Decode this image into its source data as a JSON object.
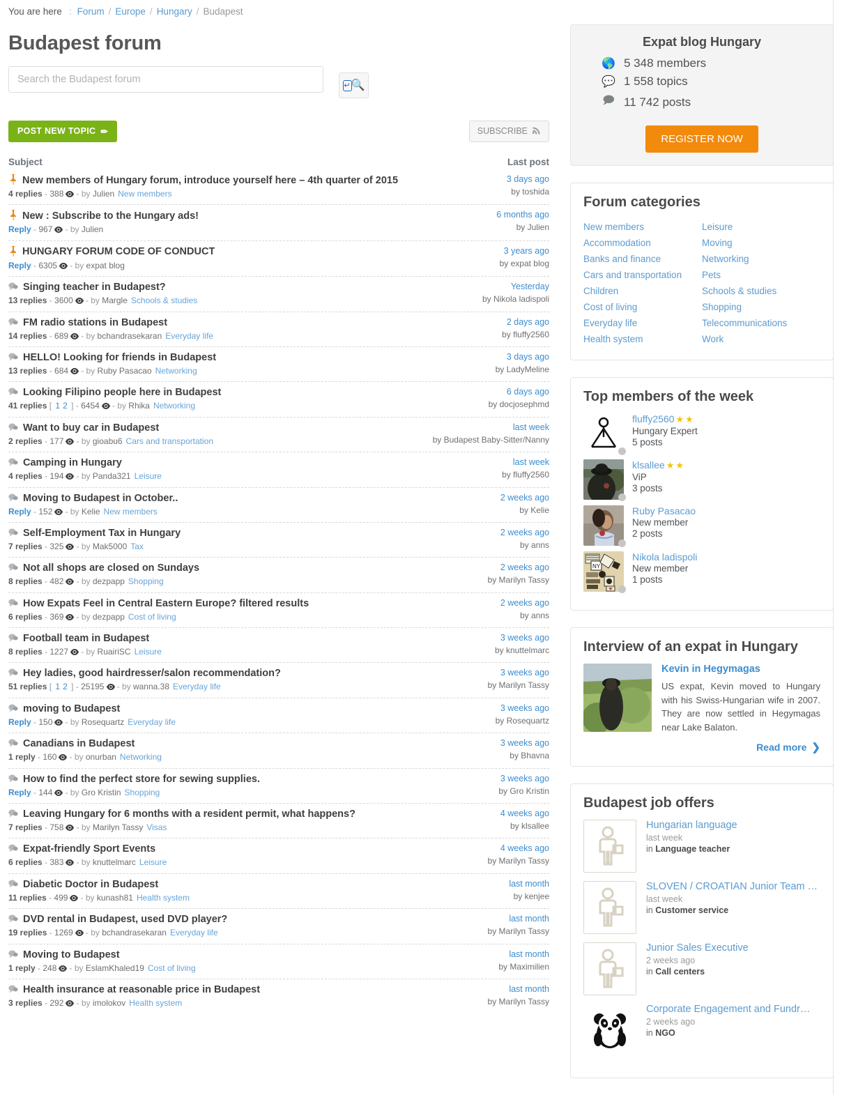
{
  "breadcrumb": {
    "label": "You are here",
    "colon": ":",
    "items": [
      "Forum",
      "Europe",
      "Hungary"
    ],
    "current": "Budapest",
    "separator": "/"
  },
  "page_title": "Budapest forum",
  "search": {
    "placeholder": "Search the Budapest forum",
    "value": ""
  },
  "toolbar": {
    "post_new_topic": "POST NEW TOPIC",
    "pencil_icon": "✏",
    "subscribe": "SUBSCRIBE",
    "rss_icon": "❧"
  },
  "table_headers": {
    "subject": "Subject",
    "last_post": "Last post"
  },
  "topics": [
    {
      "pinned": true,
      "title": "New members of Hungary forum, introduce yourself here – 4th quarter of 2015",
      "replies": "4 replies",
      "reply_link": "",
      "views": "388",
      "author": "Julien",
      "category": "New members",
      "pages": [],
      "when": "3 days ago",
      "last_by": "by toshida"
    },
    {
      "pinned": true,
      "title": "New : Subscribe to the Hungary ads!",
      "replies": "",
      "reply_link": "Reply",
      "views": "967",
      "author": "Julien",
      "category": "",
      "pages": [],
      "when": "6 months ago",
      "last_by": "by Julien"
    },
    {
      "pinned": true,
      "title": "HUNGARY FORUM CODE OF CONDUCT",
      "replies": "",
      "reply_link": "Reply",
      "views": "6305",
      "author": "expat blog",
      "category": "",
      "pages": [],
      "when": "3 years ago",
      "last_by": "by expat blog"
    },
    {
      "pinned": false,
      "title": "Singing teacher in Budapest?",
      "replies": "13 replies",
      "reply_link": "",
      "views": "3600",
      "author": "Margle",
      "category": "Schools & studies",
      "pages": [],
      "when": "Yesterday",
      "last_by": "by Nikola ladispoli"
    },
    {
      "pinned": false,
      "title": "FM radio stations in Budapest",
      "replies": "14 replies",
      "reply_link": "",
      "views": "689",
      "author": "bchandrasekaran",
      "category": "Everyday life",
      "pages": [],
      "when": "2 days ago",
      "last_by": "by fluffy2560"
    },
    {
      "pinned": false,
      "title": "HELLO! Looking for friends in Budapest",
      "replies": "13 replies",
      "reply_link": "",
      "views": "684",
      "author": "Ruby Pasacao",
      "category": "Networking",
      "pages": [],
      "when": "3 days ago",
      "last_by": "by LadyMeline"
    },
    {
      "pinned": false,
      "title": "Looking Filipino people here in Budapest",
      "replies": "41 replies",
      "reply_link": "",
      "views": "6454",
      "author": "Rhika",
      "category": "Networking",
      "pages": [
        "1",
        "2"
      ],
      "when": "6 days ago",
      "last_by": "by docjosephmd"
    },
    {
      "pinned": false,
      "title": "Want to buy car in Budapest",
      "replies": "2 replies",
      "reply_link": "",
      "views": "177",
      "author": "gioabu6",
      "category": "Cars and transportation",
      "pages": [],
      "when": "last week",
      "last_by": "by Budapest Baby-Sitter/Nanny"
    },
    {
      "pinned": false,
      "title": "Camping in Hungary",
      "replies": "4 replies",
      "reply_link": "",
      "views": "194",
      "author": "Panda321",
      "category": "Leisure",
      "pages": [],
      "when": "last week",
      "last_by": "by fluffy2560"
    },
    {
      "pinned": false,
      "title": "Moving to Budapest in October..",
      "replies": "",
      "reply_link": "Reply",
      "views": "152",
      "author": "Kelie",
      "category": "New members",
      "pages": [],
      "when": "2 weeks ago",
      "last_by": "by Kelie"
    },
    {
      "pinned": false,
      "title": "Self-Employment Tax in Hungary",
      "replies": "7 replies",
      "reply_link": "",
      "views": "325",
      "author": "Mak5000",
      "category": "Tax",
      "pages": [],
      "when": "2 weeks ago",
      "last_by": "by anns"
    },
    {
      "pinned": false,
      "title": "Not all shops are closed on Sundays",
      "replies": "8 replies",
      "reply_link": "",
      "views": "482",
      "author": "dezpapp",
      "category": "Shopping",
      "pages": [],
      "when": "2 weeks ago",
      "last_by": "by Marilyn Tassy"
    },
    {
      "pinned": false,
      "title": "How Expats Feel in Central Eastern Europe? filtered results",
      "replies": "6 replies",
      "reply_link": "",
      "views": "369",
      "author": "dezpapp",
      "category": "Cost of living",
      "pages": [],
      "when": "2 weeks ago",
      "last_by": "by anns"
    },
    {
      "pinned": false,
      "title": "Football team in Budapest",
      "replies": "8 replies",
      "reply_link": "",
      "views": "1227",
      "author": "RuairiSC",
      "category": "Leisure",
      "pages": [],
      "when": "3 weeks ago",
      "last_by": "by knuttelmarc"
    },
    {
      "pinned": false,
      "title": "Hey ladies, good hairdresser/salon recommendation?",
      "replies": "51 replies",
      "reply_link": "",
      "views": "25195",
      "author": "wanna.38",
      "category": "Everyday life",
      "pages": [
        "1",
        "2"
      ],
      "when": "3 weeks ago",
      "last_by": "by Marilyn Tassy"
    },
    {
      "pinned": false,
      "title": "moving to Budapest",
      "replies": "",
      "reply_link": "Reply",
      "views": "150",
      "author": "Rosequartz",
      "category": "Everyday life",
      "pages": [],
      "when": "3 weeks ago",
      "last_by": "by Rosequartz"
    },
    {
      "pinned": false,
      "title": "Canadians in Budapest",
      "replies": "1 reply",
      "reply_link": "",
      "views": "160",
      "author": "onurban",
      "category": "Networking",
      "pages": [],
      "when": "3 weeks ago",
      "last_by": "by Bhavna"
    },
    {
      "pinned": false,
      "title": "How to find the perfect store for sewing supplies.",
      "replies": "",
      "reply_link": "Reply",
      "views": "144",
      "author": "Gro Kristin",
      "category": "Shopping",
      "pages": [],
      "when": "3 weeks ago",
      "last_by": "by Gro Kristin"
    },
    {
      "pinned": false,
      "title": "Leaving Hungary for 6 months with a resident permit, what happens?",
      "replies": "7 replies",
      "reply_link": "",
      "views": "758",
      "author": "Marilyn Tassy",
      "category": "Visas",
      "pages": [],
      "when": "4 weeks ago",
      "last_by": "by klsallee"
    },
    {
      "pinned": false,
      "title": "Expat-friendly Sport Events",
      "replies": "6 replies",
      "reply_link": "",
      "views": "383",
      "author": "knuttelmarc",
      "category": "Leisure",
      "pages": [],
      "when": "4 weeks ago",
      "last_by": "by Marilyn Tassy"
    },
    {
      "pinned": false,
      "title": "Diabetic Doctor in Budapest",
      "replies": "11 replies",
      "reply_link": "",
      "views": "499",
      "author": "kunash81",
      "category": "Health system",
      "pages": [],
      "when": "last month",
      "last_by": "by kenjee"
    },
    {
      "pinned": false,
      "title": "DVD rental in Budapest, used DVD player?",
      "replies": "19 replies",
      "reply_link": "",
      "views": "1269",
      "author": "bchandrasekaran",
      "category": "Everyday life",
      "pages": [],
      "when": "last month",
      "last_by": "by Marilyn Tassy"
    },
    {
      "pinned": false,
      "title": "Moving to Budapest",
      "replies": "1 reply",
      "reply_link": "",
      "views": "248",
      "author": "EslamKhaled19",
      "category": "Cost of living",
      "pages": [],
      "when": "last month",
      "last_by": "by Maximilien"
    },
    {
      "pinned": false,
      "title": "Health insurance at reasonable price in Budapest",
      "replies": "3 replies",
      "reply_link": "",
      "views": "292",
      "author": "imolokov",
      "category": "Health system",
      "pages": [],
      "when": "last month",
      "last_by": "by Marilyn Tassy"
    }
  ],
  "stats": {
    "title": "Expat blog Hungary",
    "members": "5 348 members",
    "topics": "1 558 topics",
    "posts": "11 742 posts",
    "register": "REGISTER NOW"
  },
  "categories": {
    "title": "Forum categories",
    "left": [
      "New members",
      "Accommodation",
      "Banks and finance",
      "Cars and transportation",
      "Children",
      "Cost of living",
      "Everyday life",
      "Health system"
    ],
    "right": [
      "Leisure",
      "Moving",
      "Networking",
      "Pets",
      "Schools & studies",
      "Shopping",
      "Telecommunications",
      "Work"
    ]
  },
  "top_members": {
    "title": "Top members of the week",
    "items": [
      {
        "name": "fluffy2560",
        "stars": 2,
        "role": "Hungary Expert",
        "posts": "5 posts",
        "avatar": "stick-figure"
      },
      {
        "name": "klsallee",
        "stars": 2,
        "role": "ViP",
        "posts": "3 posts",
        "avatar": "photo-hat"
      },
      {
        "name": "Ruby Pasacao",
        "stars": 0,
        "role": "New member",
        "posts": "2 posts",
        "avatar": "photo-woman"
      },
      {
        "name": "Nikola ladispoli",
        "stars": 0,
        "role": "New member",
        "posts": "1 posts",
        "avatar": "collage"
      }
    ]
  },
  "interview": {
    "title": "Interview of an expat in Hungary",
    "name": "Kevin in Hegymagas",
    "text": "US expat, Kevin moved to Hungary with his Swiss-Hungarian wife in 2007. They are now settled in Hegymagas near Lake Balaton.",
    "read_more": "Read more"
  },
  "jobs": {
    "title": "Budapest job offers",
    "items": [
      {
        "title": "Hungarian language",
        "when": "last week",
        "in_label": "in",
        "field": "Language teacher",
        "icon": "person-placeholder"
      },
      {
        "title": "SLOVEN / CROATIAN Junior Team …",
        "when": "last week",
        "in_label": "in",
        "field": "Customer service",
        "icon": "person-placeholder"
      },
      {
        "title": "Junior Sales Executive",
        "when": "2 weeks ago",
        "in_label": "in",
        "field": "Call centers",
        "icon": "person-placeholder"
      },
      {
        "title": "Corporate Engagement and Fundr…",
        "when": "2 weeks ago",
        "in_label": "in",
        "field": "NGO",
        "icon": "wwf-panda"
      }
    ]
  },
  "colors": {
    "accent_green": "#7ab317",
    "accent_orange": "#f28a0c",
    "link_blue": "#5b9bd1",
    "pin_orange": "#e8891c",
    "star_yellow": "#f5c20a"
  }
}
